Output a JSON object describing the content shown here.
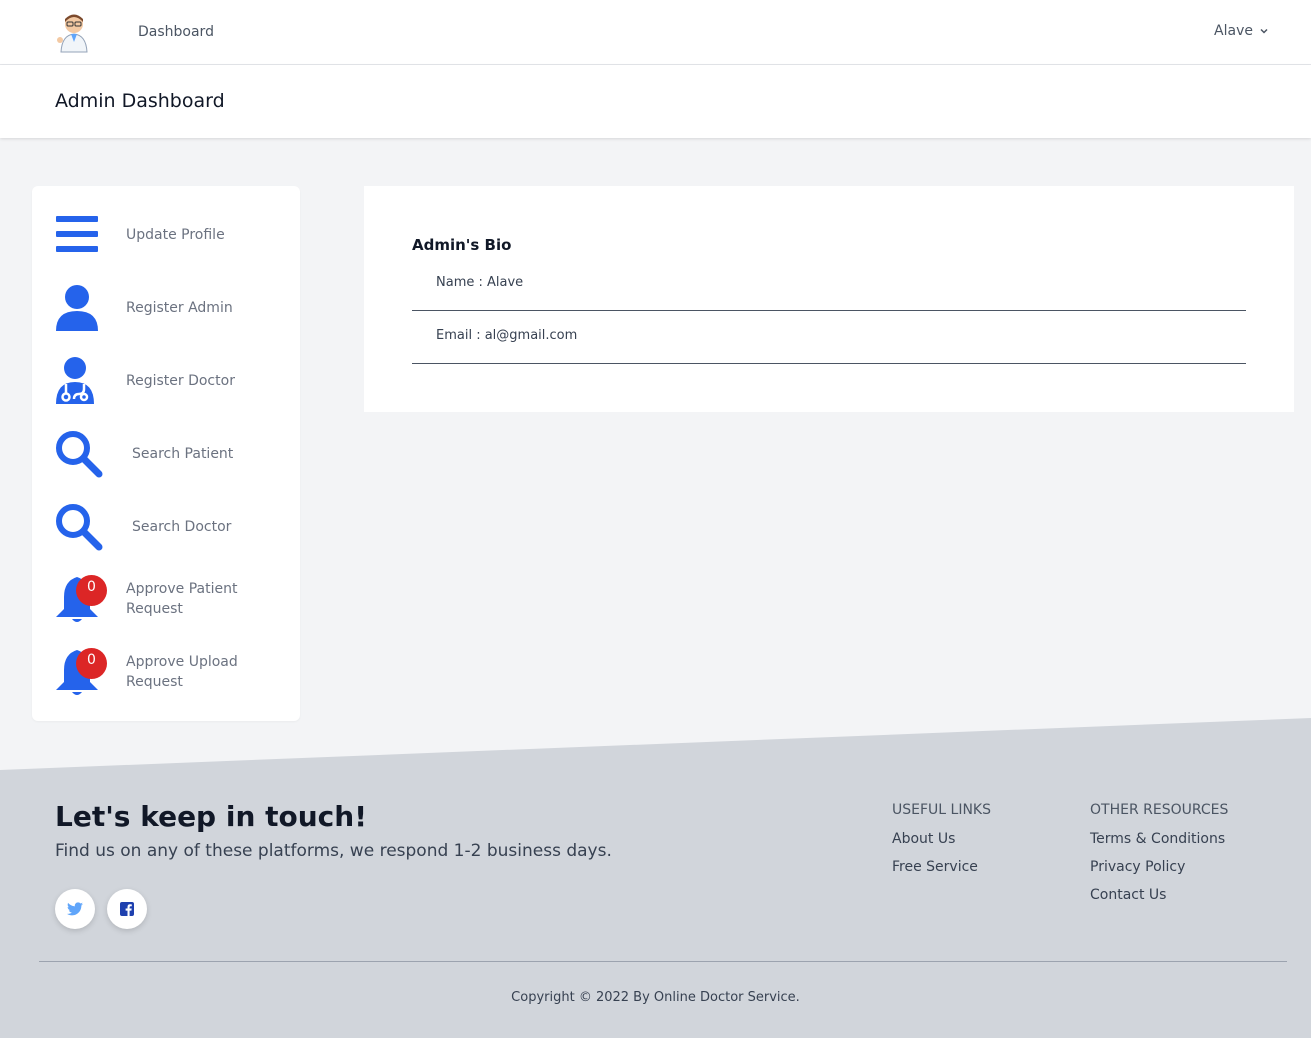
{
  "nav": {
    "dashboard_label": "Dashboard",
    "user_name": "Alave"
  },
  "header": {
    "title": "Admin Dashboard"
  },
  "sidebar": {
    "items": [
      {
        "label": "Update Profile",
        "icon": "menu-icon"
      },
      {
        "label": "Register Admin",
        "icon": "user-icon"
      },
      {
        "label": "Register Doctor",
        "icon": "doctor-icon"
      },
      {
        "label": "Search Patient",
        "icon": "search-icon"
      },
      {
        "label": "Search Doctor",
        "icon": "search-icon"
      },
      {
        "label": "Approve Patient Request",
        "line1": "Approve Patient",
        "line2": "Request",
        "icon": "bell-icon",
        "badge": "0"
      },
      {
        "label": "Approve Upload Request",
        "line1": "Approve Upload",
        "line2": "Request",
        "icon": "bell-icon",
        "badge": "0"
      }
    ]
  },
  "bio": {
    "title": "Admin's Bio",
    "name": "Name : Alave",
    "email": "Email : al@gmail.com"
  },
  "footer": {
    "title": "Let's keep in touch!",
    "subtitle": "Find us on any of these platforms, we respond 1-2 business days.",
    "social": [
      {
        "icon": "twitter-icon"
      },
      {
        "icon": "facebook-icon"
      }
    ],
    "useful_links": {
      "heading": "USEFUL LINKS",
      "links": [
        "About Us",
        "Free Service"
      ]
    },
    "other_resources": {
      "heading": "OTHER RESOURCES",
      "links": [
        "Terms & Conditions",
        "Privacy Policy",
        "Contact Us"
      ]
    },
    "copyright": "Copyright © 2022 By Online Doctor Service."
  },
  "colors": {
    "accent": "#2563eb",
    "badge": "#dc2626",
    "footer_bg": "#d1d5db",
    "page_bg": "#f3f4f6"
  }
}
